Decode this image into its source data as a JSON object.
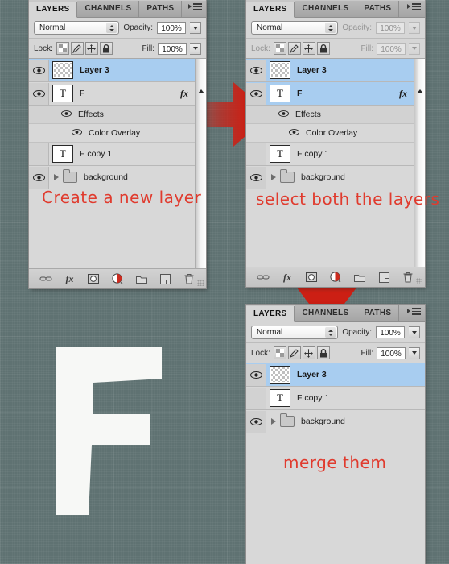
{
  "canvas": {
    "background_color": "#5f7272",
    "big_letter": "F",
    "big_letter_color": "#f7f8f6"
  },
  "annotations": [
    {
      "id": "create-new-layer",
      "text": "Create a new layer",
      "color": "#e03b2e"
    },
    {
      "id": "select-both-layers",
      "text": "select both the layers",
      "color": "#e03b2e"
    },
    {
      "id": "merge-them",
      "text": "merge them",
      "color": "#e03b2e"
    }
  ],
  "arrows": [
    {
      "id": "arrow-right",
      "direction": "right",
      "color": "#cc1f14"
    },
    {
      "id": "arrow-down",
      "direction": "down",
      "color": "#cc1f14"
    }
  ],
  "panels": [
    {
      "id": "panel-1",
      "tabs": [
        {
          "label": "LAYERS",
          "active": true
        },
        {
          "label": "CHANNELS",
          "active": false
        },
        {
          "label": "PATHS",
          "active": false
        }
      ],
      "blend": {
        "mode": "Normal",
        "opacity_label": "Opacity:",
        "opacity_value": "100%",
        "disabled": false
      },
      "lock": {
        "label": "Lock:",
        "buttons": [
          "lock-transparency-icon",
          "lock-image-icon",
          "lock-position-icon",
          "lock-all-icon"
        ],
        "fill_label": "Fill:",
        "fill_value": "100%",
        "disabled": false
      },
      "layers": [
        {
          "type": "layer",
          "name": "Layer 3",
          "visible": true,
          "selected": true,
          "thumb": "checker",
          "bold": true,
          "fx": ""
        },
        {
          "type": "layer",
          "name": "F",
          "visible": true,
          "selected": false,
          "thumb": "T",
          "bold": false,
          "fx": "fx"
        },
        {
          "type": "effects-group",
          "name": "Effects",
          "visible": true
        },
        {
          "type": "effect",
          "name": "Color Overlay",
          "visible": true
        },
        {
          "type": "layer",
          "name": "F copy 1",
          "visible": false,
          "selected": false,
          "thumb": "T",
          "bold": false,
          "fx": ""
        },
        {
          "type": "group",
          "name": "background",
          "visible": true,
          "selected": false
        }
      ],
      "footer_buttons": [
        "link-layers-icon",
        "layer-style-fx-icon",
        "layer-mask-icon",
        "adjustment-layer-icon",
        "new-group-icon",
        "new-layer-icon",
        "delete-layer-icon"
      ],
      "scrollbar": true
    },
    {
      "id": "panel-2",
      "tabs": [
        {
          "label": "LAYERS",
          "active": true
        },
        {
          "label": "CHANNELS",
          "active": false
        },
        {
          "label": "PATHS",
          "active": false
        }
      ],
      "blend": {
        "mode": "Normal",
        "opacity_label": "Opacity:",
        "opacity_value": "100%",
        "disabled": true
      },
      "lock": {
        "label": "Lock:",
        "buttons": [
          "lock-transparency-icon",
          "lock-image-icon",
          "lock-position-icon",
          "lock-all-icon"
        ],
        "fill_label": "Fill:",
        "fill_value": "100%",
        "disabled": true
      },
      "layers": [
        {
          "type": "layer",
          "name": "Layer 3",
          "visible": true,
          "selected": true,
          "thumb": "checker",
          "bold": true,
          "fx": ""
        },
        {
          "type": "layer",
          "name": "F",
          "visible": true,
          "selected": true,
          "thumb": "T",
          "bold": true,
          "fx": "fx"
        },
        {
          "type": "effects-group",
          "name": "Effects",
          "visible": true
        },
        {
          "type": "effect",
          "name": "Color Overlay",
          "visible": true
        },
        {
          "type": "layer",
          "name": "F copy 1",
          "visible": false,
          "selected": false,
          "thumb": "T",
          "bold": false,
          "fx": ""
        },
        {
          "type": "group",
          "name": "background",
          "visible": true,
          "selected": false
        }
      ],
      "footer_buttons": [
        "link-layers-icon",
        "layer-style-fx-icon",
        "layer-mask-icon",
        "adjustment-layer-icon",
        "new-group-icon",
        "new-layer-icon",
        "delete-layer-icon"
      ],
      "scrollbar": true
    },
    {
      "id": "panel-3",
      "tabs": [
        {
          "label": "LAYERS",
          "active": true
        },
        {
          "label": "CHANNELS",
          "active": false
        },
        {
          "label": "PATHS",
          "active": false
        }
      ],
      "blend": {
        "mode": "Normal",
        "opacity_label": "Opacity:",
        "opacity_value": "100%",
        "disabled": false
      },
      "lock": {
        "label": "Lock:",
        "buttons": [
          "lock-transparency-icon",
          "lock-image-icon",
          "lock-position-icon",
          "lock-all-icon"
        ],
        "fill_label": "Fill:",
        "fill_value": "100%",
        "disabled": false
      },
      "layers": [
        {
          "type": "layer",
          "name": "Layer 3",
          "visible": true,
          "selected": true,
          "thumb": "checker",
          "bold": true,
          "fx": ""
        },
        {
          "type": "layer",
          "name": "F copy 1",
          "visible": false,
          "selected": false,
          "thumb": "T",
          "bold": false,
          "fx": ""
        },
        {
          "type": "group",
          "name": "background",
          "visible": true,
          "selected": false
        }
      ],
      "footer_buttons": [],
      "scrollbar": false
    }
  ]
}
